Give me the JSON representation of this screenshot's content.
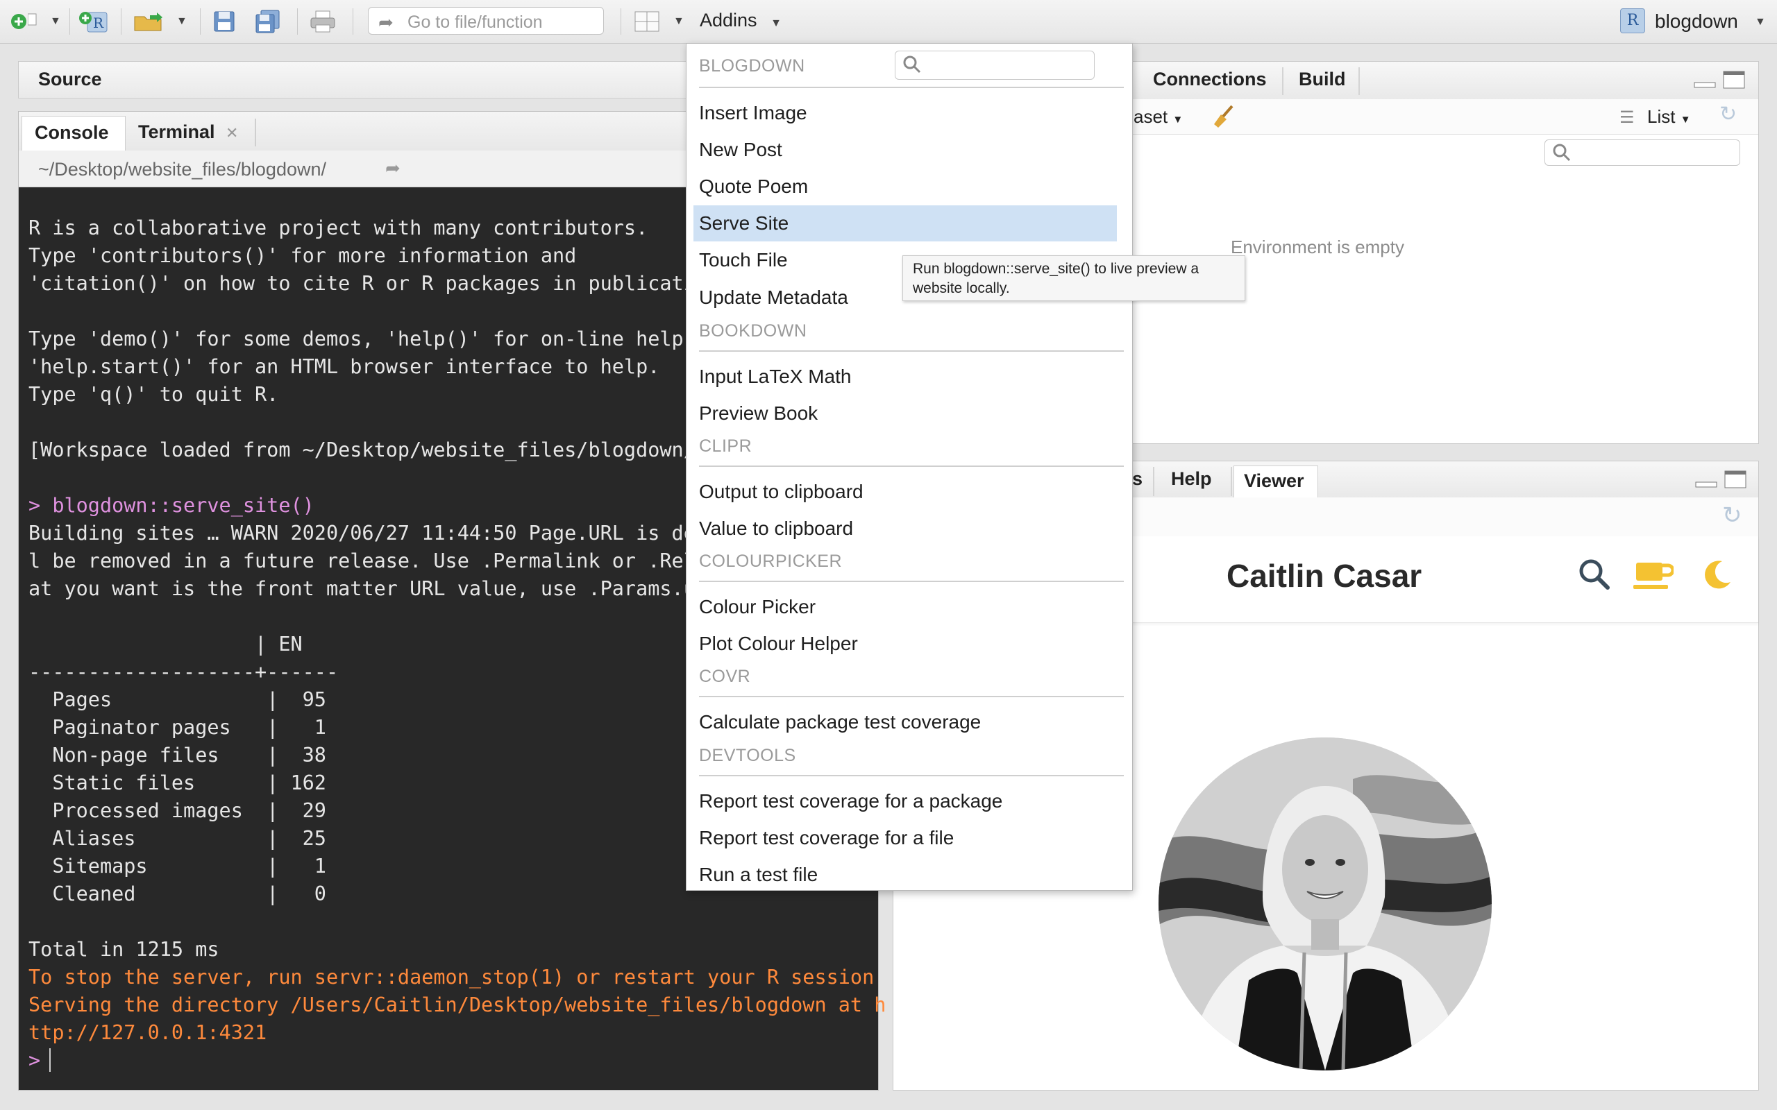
{
  "toolbar": {
    "goto_placeholder": "Go to file/function",
    "addins_label": "Addins",
    "project_name": "blogdown",
    "project_letter": "R"
  },
  "source": {
    "title": "Source"
  },
  "console": {
    "tabs": [
      "Console",
      "Terminal"
    ],
    "path": "~/Desktop/website_files/blogdown/",
    "lines": [
      {
        "t": "R is a collaborative project with many contributors.",
        "c": ""
      },
      {
        "t": "Type 'contributors()' for more information and",
        "c": ""
      },
      {
        "t": "'citation()' on how to cite R or R packages in publicatio",
        "c": ""
      },
      {
        "t": "",
        "c": ""
      },
      {
        "t": "Type 'demo()' for some demos, 'help()' for on-line help,",
        "c": ""
      },
      {
        "t": "'help.start()' for an HTML browser interface to help.",
        "c": ""
      },
      {
        "t": "Type 'q()' to quit R.",
        "c": ""
      },
      {
        "t": "",
        "c": ""
      },
      {
        "t": "[Workspace loaded from ~/Desktop/website_files/blogdown/.",
        "c": ""
      },
      {
        "t": "",
        "c": ""
      },
      {
        "t": "> blogdown::serve_site()",
        "c": "cmd"
      },
      {
        "t": "Building sites … WARN 2020/06/27 11:44:50 Page.URL is dep",
        "c": ""
      },
      {
        "t": "l be removed in a future release. Use .Permalink or .RelP",
        "c": ""
      },
      {
        "t": "at you want is the front matter URL value, use .Params.ur",
        "c": ""
      },
      {
        "t": "",
        "c": ""
      },
      {
        "t": "                   | EN",
        "c": ""
      },
      {
        "t": "-------------------+------",
        "c": ""
      },
      {
        "t": "  Pages             |  95",
        "c": ""
      },
      {
        "t": "  Paginator pages   |   1",
        "c": ""
      },
      {
        "t": "  Non-page files    |  38",
        "c": ""
      },
      {
        "t": "  Static files      | 162",
        "c": ""
      },
      {
        "t": "  Processed images  |  29",
        "c": ""
      },
      {
        "t": "  Aliases           |  25",
        "c": ""
      },
      {
        "t": "  Sitemaps          |   1",
        "c": ""
      },
      {
        "t": "  Cleaned           |   0",
        "c": ""
      },
      {
        "t": "",
        "c": ""
      },
      {
        "t": "Total in 1215 ms",
        "c": ""
      },
      {
        "t": "To stop the server, run servr::daemon_stop(1) or restart your R session",
        "c": "warn"
      },
      {
        "t": "Serving the directory /Users/Caitlin/Desktop/website_files/blogdown at h",
        "c": "warn"
      },
      {
        "t": "ttp://127.0.0.1:4321",
        "c": "warn"
      },
      {
        "t": ">",
        "c": "prompt"
      }
    ]
  },
  "env": {
    "tabs": [
      "Connections",
      "Build"
    ],
    "dataset_fragment": "aset",
    "list_label": "List",
    "empty_text": "Environment is empty"
  },
  "viewer": {
    "tabs_fragment": "s",
    "tabs": [
      "Help",
      "Viewer"
    ],
    "site_title": "Caitlin Casar",
    "accent_color": "#f4c232"
  },
  "addins_menu": {
    "groups": [
      {
        "header": "BLOGDOWN",
        "items": [
          "Insert Image",
          "New Post",
          "Quote Poem",
          "Serve Site",
          "Touch File",
          "Update Metadata"
        ]
      },
      {
        "header": "BOOKDOWN",
        "items": [
          "Input LaTeX Math",
          "Preview Book"
        ]
      },
      {
        "header": "CLIPR",
        "items": [
          "Output to clipboard",
          "Value to clipboard"
        ]
      },
      {
        "header": "COLOURPICKER",
        "items": [
          "Colour Picker",
          "Plot Colour Helper"
        ]
      },
      {
        "header": "COVR",
        "items": [
          "Calculate package test coverage"
        ]
      },
      {
        "header": "DEVTOOLS",
        "items": [
          "Report test coverage for a package",
          "Report test coverage for a file",
          "Run a test file"
        ]
      }
    ],
    "highlighted": "Serve Site",
    "tooltip": "Run blogdown::serve_site() to live preview a website locally."
  }
}
